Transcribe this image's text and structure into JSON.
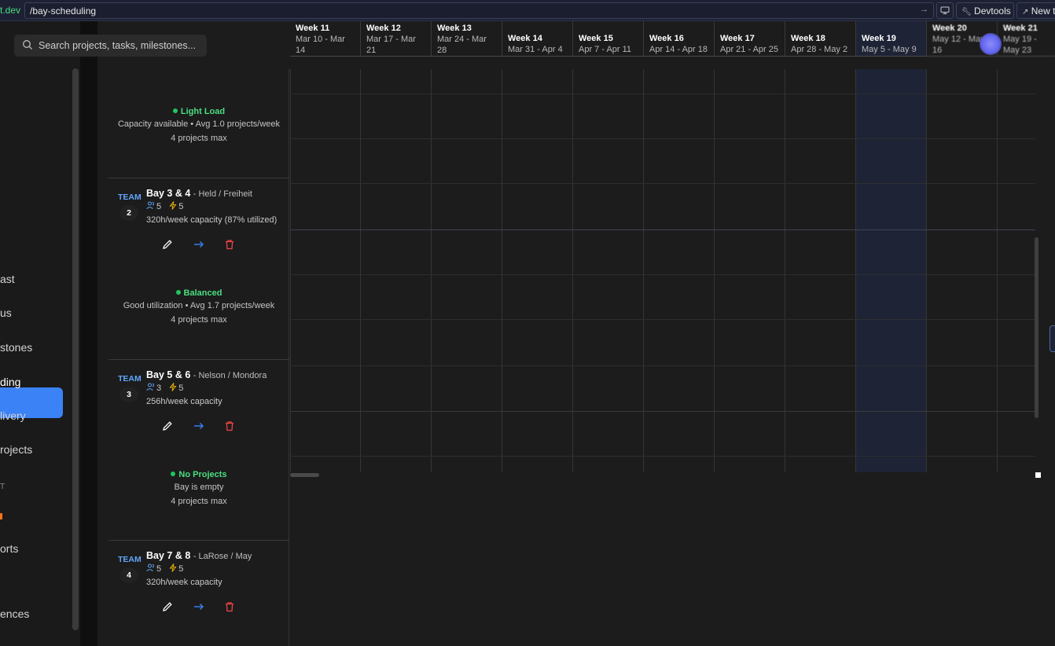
{
  "browser": {
    "host_fragment": "t.dev",
    "path": "/bay-scheduling",
    "devtools_label": "Devtools",
    "new_label": "New t"
  },
  "sidebar": {
    "items": [
      "ast",
      "us",
      "stones",
      "ding",
      "livery",
      "rojects",
      "orts",
      "ences"
    ],
    "active_index": 3,
    "section_fragment": "T"
  },
  "search": {
    "placeholder": "Search projects, tasks, milestones..."
  },
  "weeks": [
    {
      "title": "Week 11",
      "dates": "Mar 10 - Mar 14"
    },
    {
      "title": "Week 12",
      "dates": "Mar 17 - Mar 21"
    },
    {
      "title": "Week 13",
      "dates": "Mar 24 - Mar 28"
    },
    {
      "title": "Week 14",
      "dates": "Mar 31 - Apr 4"
    },
    {
      "title": "Week 15",
      "dates": "Apr 7 - Apr 11"
    },
    {
      "title": "Week 16",
      "dates": "Apr 14 - Apr 18"
    },
    {
      "title": "Week 17",
      "dates": "Apr 21 - Apr 25"
    },
    {
      "title": "Week 18",
      "dates": "Apr 28 - May 2"
    },
    {
      "title": "Week 19",
      "dates": "May 5 - May 9"
    },
    {
      "title": "Week 20",
      "dates": "May 12 - May 16"
    },
    {
      "title": "Week 21",
      "dates": "May 19 - May 23"
    }
  ],
  "current_week_index": 8,
  "statuses": [
    {
      "label": "Light Load",
      "detail": "Capacity available • Avg 1.0 projects/week",
      "max": "4 projects max"
    },
    {
      "label": "Balanced",
      "detail": "Good utilization • Avg 1.7 projects/week",
      "max": "4 projects max"
    },
    {
      "label": "No Projects",
      "detail": "Bay is empty",
      "max": "4 projects max"
    }
  ],
  "teams": [
    {
      "tag": "TEAM",
      "number": "2",
      "name": "Bay 3 & 4",
      "lead": "- Held / Freiheit",
      "members": "5",
      "power": "5",
      "capacity": "320h/week capacity (87% utilized)"
    },
    {
      "tag": "TEAM",
      "number": "3",
      "name": "Bay 5 & 6",
      "lead": "- Nelson / Mondora",
      "members": "3",
      "power": "5",
      "capacity": "256h/week capacity"
    },
    {
      "tag": "TEAM",
      "number": "4",
      "name": "Bay 7 & 8",
      "lead": "- LaRose / May",
      "members": "5",
      "power": "5",
      "capacity": "320h/week capacity"
    }
  ],
  "colors": {
    "accent": "#3b82f6",
    "status_green": "#22c55e",
    "team_blue": "#60a5fa",
    "delete_red": "#ef4444",
    "power_yellow": "#eab308"
  }
}
